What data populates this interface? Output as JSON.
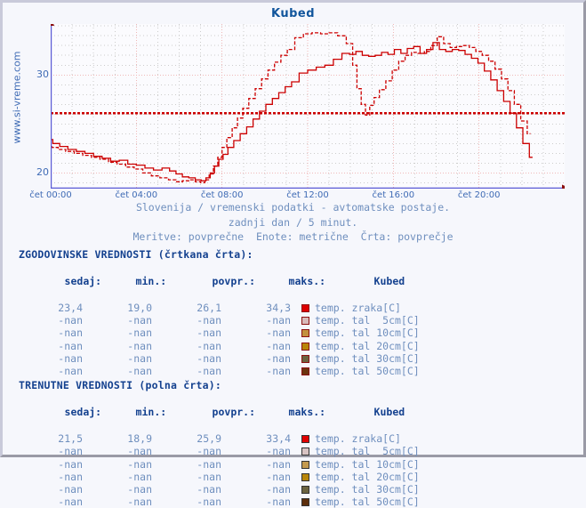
{
  "chart_title": "Kubed",
  "watermark": "www.si-vreme.com",
  "caption": {
    "line1": "Slovenija / vremenski podatki - avtomatske postaje.",
    "line2": "zadnji dan / 5 minut.",
    "line3": "Meritve: povprečne  Enote: metrične  Črta: povprečje"
  },
  "colors": {
    "axis": "#5a5ad6",
    "grid_pink": "#f0b8b8",
    "grid_gray": "#cccccc",
    "series_red": "#cc0000",
    "avg_line": "#cc0000",
    "label_blue": "#3f6bb5",
    "header_blue": "#14418f",
    "plot_bg": "#fbfbfe",
    "page_bg": "#f6f7fc"
  },
  "chart_data": {
    "type": "line",
    "title": "Kubed",
    "xlabel": "",
    "ylabel": "",
    "ylim": [
      18.4,
      35.2
    ],
    "xlim": [
      0,
      24
    ],
    "grid": true,
    "legend_position": "below-table",
    "yticks": [
      20,
      30
    ],
    "ytick_labels": [
      "20",
      "30"
    ],
    "xticks": [
      0,
      4,
      8,
      12,
      16,
      20
    ],
    "xtick_labels": [
      "čet 00:00",
      "čet 04:00",
      "čet 08:00",
      "čet 12:00",
      "čet 16:00",
      "čet 20:00"
    ],
    "annotations": [
      {
        "type": "hline",
        "label": "povprečje",
        "value": 26.1,
        "style": "dotted",
        "color": "#cc0000"
      }
    ],
    "series": [
      {
        "name": "temp. zraka[C] (zgodovinske / črtkana črta)",
        "style": "dashed",
        "color": "#cc0000",
        "x": [
          -0.85,
          -0.6,
          -0.35,
          -0.1,
          0.2,
          0.5,
          0.9,
          1.3,
          1.7,
          2.1,
          2.5,
          2.9,
          3.3,
          3.7,
          4.1,
          4.5,
          4.9,
          5.3,
          5.7,
          6.0,
          6.3,
          6.6,
          6.9,
          7.1,
          7.3,
          7.5,
          7.7,
          7.9,
          8.1,
          8.35,
          8.6,
          8.85,
          9.1,
          9.4,
          9.7,
          10.0,
          10.3,
          10.6,
          10.9,
          11.2,
          11.6,
          12.0,
          12.4,
          12.8,
          13.2,
          13.6,
          14.0,
          14.2,
          14.4,
          14.6,
          14.8,
          15.0,
          15.2,
          15.5,
          15.8,
          16.1,
          16.4,
          16.7,
          17.0,
          17.3,
          17.6,
          17.9,
          18.2,
          18.5,
          18.8,
          19.1,
          19.4,
          19.7,
          20.0,
          20.3,
          20.6,
          20.9,
          21.2,
          21.5,
          21.8,
          22.1,
          22.4
        ],
        "y": [
          23.3,
          23.4,
          23.1,
          22.9,
          22.6,
          22.4,
          22.2,
          22.0,
          21.8,
          21.6,
          21.4,
          21.1,
          20.9,
          20.6,
          20.4,
          20.0,
          19.7,
          19.5,
          19.3,
          19.1,
          19.2,
          19.3,
          19.1,
          19.0,
          19.3,
          19.9,
          20.7,
          21.6,
          22.6,
          23.6,
          24.6,
          25.6,
          26.6,
          27.6,
          28.6,
          29.6,
          30.5,
          31.3,
          32.0,
          32.6,
          33.8,
          34.2,
          34.3,
          34.2,
          34.3,
          34.0,
          33.2,
          31.0,
          28.6,
          27.0,
          25.9,
          26.9,
          27.7,
          28.5,
          29.4,
          30.5,
          31.4,
          32.0,
          32.3,
          32.2,
          32.4,
          33.0,
          33.9,
          33.2,
          32.8,
          32.9,
          33.0,
          32.8,
          32.4,
          32.0,
          31.4,
          30.6,
          29.6,
          28.4,
          27.0,
          25.3,
          24.0
        ]
      },
      {
        "name": "temp. zraka[C] (trenutne / polna črta)",
        "style": "solid",
        "color": "#cc0000",
        "x": [
          -0.85,
          -0.65,
          -0.45,
          -0.25,
          -0.05,
          0.25,
          0.6,
          1.0,
          1.4,
          1.8,
          2.2,
          2.6,
          3.0,
          3.4,
          3.8,
          4.2,
          4.6,
          5.0,
          5.4,
          5.7,
          6.0,
          6.3,
          6.6,
          6.9,
          7.15,
          7.35,
          7.55,
          7.75,
          7.95,
          8.15,
          8.4,
          8.7,
          9.0,
          9.3,
          9.6,
          9.9,
          10.2,
          10.5,
          10.8,
          11.1,
          11.4,
          11.8,
          12.2,
          12.6,
          13.0,
          13.4,
          13.8,
          14.1,
          14.4,
          14.7,
          15.0,
          15.3,
          15.6,
          15.9,
          16.2,
          16.5,
          16.8,
          17.1,
          17.4,
          17.7,
          18.0,
          18.3,
          18.6,
          18.9,
          19.2,
          19.5,
          19.8,
          20.1,
          20.4,
          20.7,
          21.0,
          21.3,
          21.6,
          21.9,
          22.2,
          22.5
        ],
        "y": [
          23.8,
          24.1,
          23.6,
          23.7,
          23.4,
          23.0,
          22.7,
          22.4,
          22.2,
          22.0,
          21.7,
          21.5,
          21.2,
          21.3,
          20.9,
          20.8,
          20.5,
          20.3,
          20.5,
          20.2,
          19.9,
          19.6,
          19.5,
          19.3,
          19.2,
          19.5,
          20.0,
          20.7,
          21.4,
          21.9,
          22.6,
          23.3,
          24.0,
          24.7,
          25.5,
          26.3,
          27.0,
          27.6,
          28.2,
          28.8,
          29.3,
          30.2,
          30.5,
          30.8,
          31.0,
          31.6,
          32.2,
          32.1,
          32.4,
          32.0,
          31.9,
          32.0,
          32.3,
          32.1,
          32.6,
          32.2,
          32.7,
          32.9,
          32.2,
          32.6,
          33.3,
          32.6,
          32.4,
          32.6,
          32.5,
          32.1,
          31.7,
          31.2,
          30.4,
          29.5,
          28.4,
          27.3,
          26.1,
          24.6,
          23.0,
          21.6
        ]
      }
    ]
  },
  "historical": {
    "section_title": "ZGODOVINSKE VREDNOSTI (črtkana črta):",
    "headers": {
      "now": "sedaj:",
      "min": "min.:",
      "avg": "povpr.:",
      "max": "maks.:",
      "station": "Kubed"
    },
    "rows": [
      {
        "now": "23,4",
        "min": "19,0",
        "avg": "26,1",
        "max": "34,3",
        "label": "temp. zraka[C]",
        "color": "#dd0000",
        "border": "#8c1010"
      },
      {
        "now": "-nan",
        "min": "-nan",
        "avg": "-nan",
        "max": "-nan",
        "label": "temp. tal  5cm[C]",
        "color": "#d8b9b9",
        "border": "#8c1010"
      },
      {
        "now": "-nan",
        "min": "-nan",
        "avg": "-nan",
        "max": "-nan",
        "label": "temp. tal 10cm[C]",
        "color": "#c2913f",
        "border": "#8c1010"
      },
      {
        "now": "-nan",
        "min": "-nan",
        "avg": "-nan",
        "max": "-nan",
        "label": "temp. tal 20cm[C]",
        "color": "#b8860b",
        "border": "#8c1010"
      },
      {
        "now": "-nan",
        "min": "-nan",
        "avg": "-nan",
        "max": "-nan",
        "label": "temp. tal 30cm[C]",
        "color": "#6b6340",
        "border": "#8c1010"
      },
      {
        "now": "-nan",
        "min": "-nan",
        "avg": "-nan",
        "max": "-nan",
        "label": "temp. tal 50cm[C]",
        "color": "#6b3410",
        "border": "#8c1010"
      }
    ]
  },
  "current": {
    "section_title": "TRENUTNE VREDNOSTI (polna črta):",
    "headers": {
      "now": "sedaj:",
      "min": "min.:",
      "avg": "povpr.:",
      "max": "maks.:",
      "station": "Kubed"
    },
    "rows": [
      {
        "now": "21,5",
        "min": "18,9",
        "avg": "25,9",
        "max": "33,4",
        "label": "temp. zraka[C]",
        "color": "#e00000",
        "border": "#333333"
      },
      {
        "now": "-nan",
        "min": "-nan",
        "avg": "-nan",
        "max": "-nan",
        "label": "temp. tal  5cm[C]",
        "color": "#d8c3c3",
        "border": "#333333"
      },
      {
        "now": "-nan",
        "min": "-nan",
        "avg": "-nan",
        "max": "-nan",
        "label": "temp. tal 10cm[C]",
        "color": "#c49a4e",
        "border": "#333333"
      },
      {
        "now": "-nan",
        "min": "-nan",
        "avg": "-nan",
        "max": "-nan",
        "label": "temp. tal 20cm[C]",
        "color": "#b8860b",
        "border": "#333333"
      },
      {
        "now": "-nan",
        "min": "-nan",
        "avg": "-nan",
        "max": "-nan",
        "label": "temp. tal 30cm[C]",
        "color": "#6b6340",
        "border": "#333333"
      },
      {
        "now": "-nan",
        "min": "-nan",
        "avg": "-nan",
        "max": "-nan",
        "label": "temp. tal 50cm[C]",
        "color": "#5c2e0c",
        "border": "#333333"
      }
    ]
  }
}
